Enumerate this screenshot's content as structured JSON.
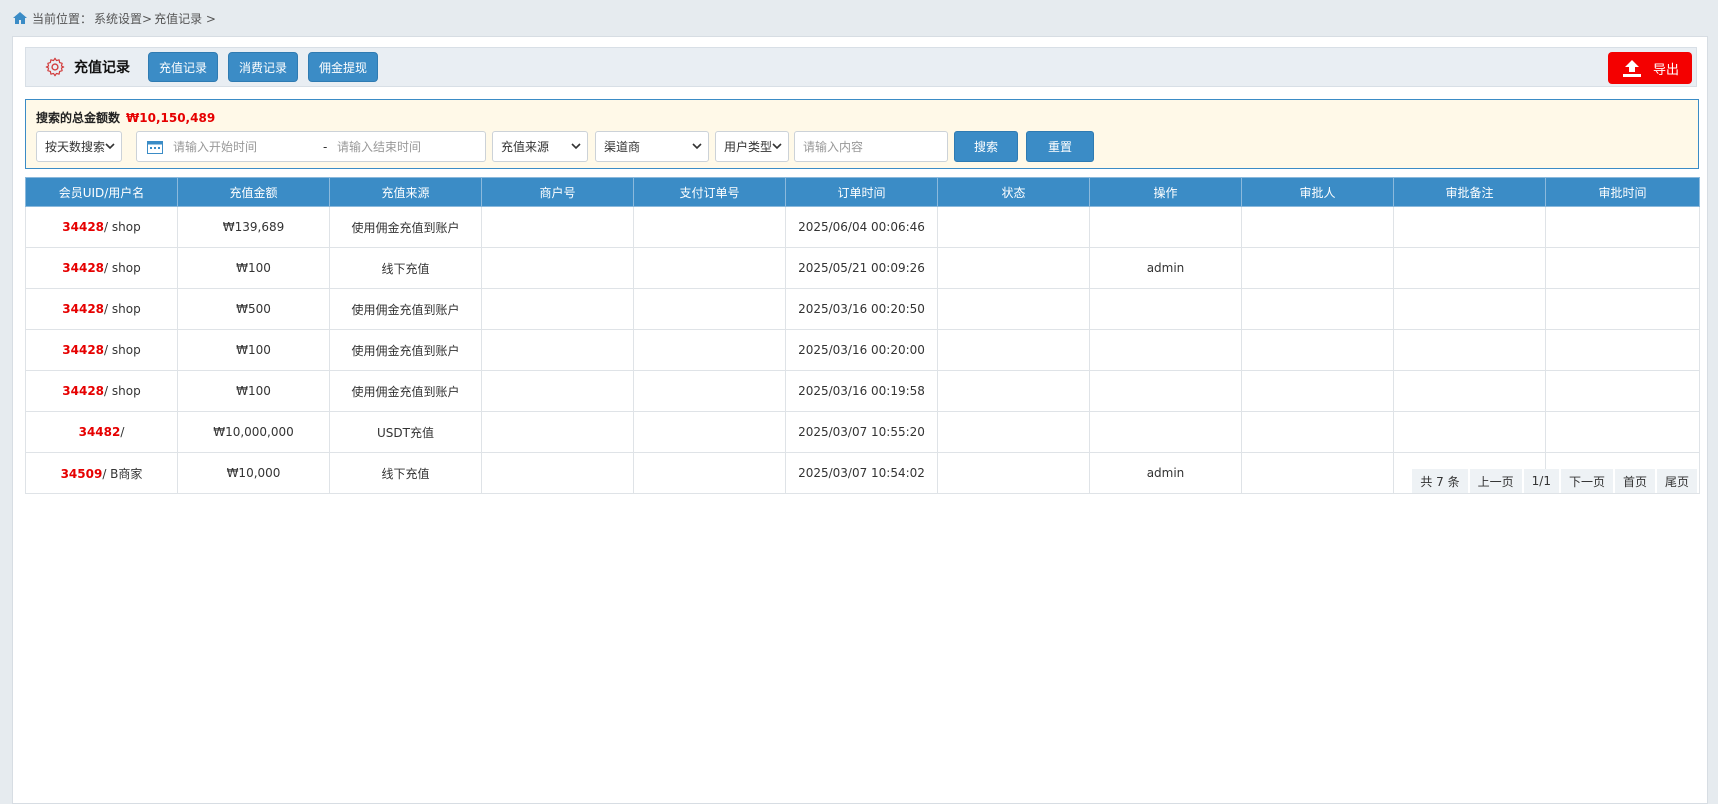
{
  "breadcrumb": {
    "prefix": "当前位置：",
    "item1": "系统设置>",
    "item2": "充值记录 >"
  },
  "header": {
    "title": "充值记录",
    "tabs": [
      "充值记录",
      "消费记录",
      "佣金提现"
    ],
    "export_label": "导出",
    "export_color": "#f40000",
    "accent_color": "#3b8cc6"
  },
  "filters": {
    "summary_label": "搜索的总金额数",
    "summary_amount": "₩10,150,489",
    "mode_select": "按天数搜索",
    "start_placeholder": "请输入开始时间",
    "range_separator": "-",
    "end_placeholder": "请输入结束时间",
    "source_select": "充值来源",
    "channel_select": "渠道商",
    "user_type_select": "用户类型",
    "keyword_placeholder": "请输入内容",
    "search_label": "搜索",
    "reset_label": "重置"
  },
  "table": {
    "columns": [
      "会员UID/用户名",
      "充值金额",
      "充值来源",
      "商户号",
      "支付订单号",
      "订单时间",
      "状态",
      "操作",
      "审批人",
      "审批备注",
      "审批时间"
    ],
    "rows": [
      {
        "uid": "34428",
        "name": "/ shop",
        "amount": "₩139,689",
        "source": "使用佣金充值到账户",
        "merchant": "",
        "order_no": "",
        "time": "2025/06/04 00:06:46",
        "status": "",
        "op": "",
        "approver": "",
        "note": "",
        "approve_time": ""
      },
      {
        "uid": "34428",
        "name": "/ shop",
        "amount": "₩100",
        "source": "线下充值",
        "merchant": "",
        "order_no": "",
        "time": "2025/05/21 00:09:26",
        "status": "",
        "op": "admin",
        "approver": "",
        "note": "",
        "approve_time": ""
      },
      {
        "uid": "34428",
        "name": "/ shop",
        "amount": "₩500",
        "source": "使用佣金充值到账户",
        "merchant": "",
        "order_no": "",
        "time": "2025/03/16 00:20:50",
        "status": "",
        "op": "",
        "approver": "",
        "note": "",
        "approve_time": ""
      },
      {
        "uid": "34428",
        "name": "/ shop",
        "amount": "₩100",
        "source": "使用佣金充值到账户",
        "merchant": "",
        "order_no": "",
        "time": "2025/03/16 00:20:00",
        "status": "",
        "op": "",
        "approver": "",
        "note": "",
        "approve_time": ""
      },
      {
        "uid": "34428",
        "name": "/ shop",
        "amount": "₩100",
        "source": "使用佣金充值到账户",
        "merchant": "",
        "order_no": "",
        "time": "2025/03/16 00:19:58",
        "status": "",
        "op": "",
        "approver": "",
        "note": "",
        "approve_time": ""
      },
      {
        "uid": "34482",
        "name": "/",
        "amount": "₩10,000,000",
        "source": "USDT充值",
        "merchant": "",
        "order_no": "",
        "time": "2025/03/07 10:55:20",
        "status": "",
        "op": "",
        "approver": "",
        "note": "",
        "approve_time": ""
      },
      {
        "uid": "34509",
        "name": "/ B商家",
        "amount": "₩10,000",
        "source": "线下充值",
        "merchant": "",
        "order_no": "",
        "time": "2025/03/07 10:54:02",
        "status": "",
        "op": "admin",
        "approver": "",
        "note": "",
        "approve_time": ""
      }
    ]
  },
  "pagination": {
    "total": "共 7 条",
    "prev": "上一页",
    "page": "1/1",
    "next": "下一页",
    "first": "首页",
    "last": "尾页"
  }
}
